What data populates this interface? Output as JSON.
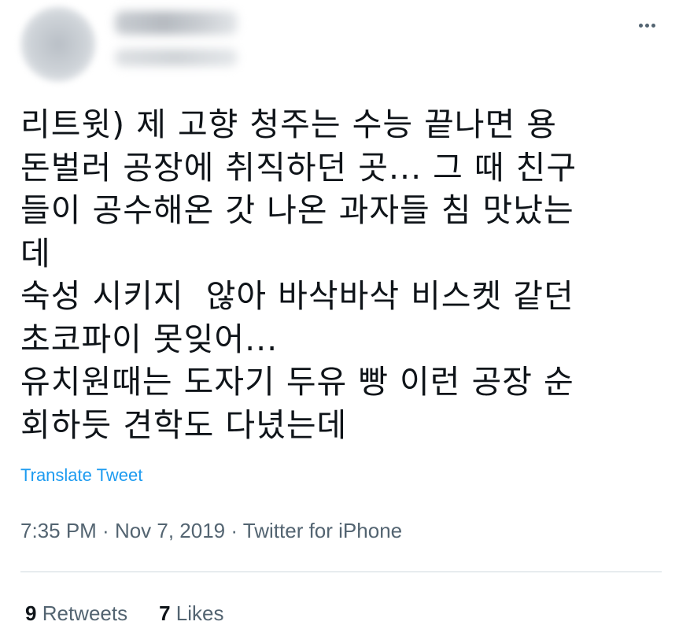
{
  "header": {
    "more_icon": "more-horizontal-icon"
  },
  "tweet": {
    "lines": [
      "리트윗) 제 고향 청주는 수능 끝나면 용",
      "돈벌러 공장에 취직하던 곳... 그 때 친구",
      "들이 공수해온 갓 나온 과자들 침 맛났는",
      "데",
      "숙성 시키지  않아 바삭바삭 비스켓 같던",
      "초코파이 못잊어...",
      "유치원때는 도자기 두유 빵 이런 공장 순",
      "회하듯 견학도 다녔는데"
    ],
    "translate_label": "Translate Tweet"
  },
  "meta": {
    "time": "7:35 PM",
    "separator": " · ",
    "date": "Nov 7, 2019",
    "source": "Twitter for iPhone"
  },
  "stats": {
    "retweets_count": "9",
    "retweets_label": "Retweets",
    "likes_count": "7",
    "likes_label": "Likes"
  },
  "colors": {
    "text": "#0f1419",
    "secondary": "#536471",
    "link": "#1d9bf0",
    "divider": "#cfd9de"
  }
}
